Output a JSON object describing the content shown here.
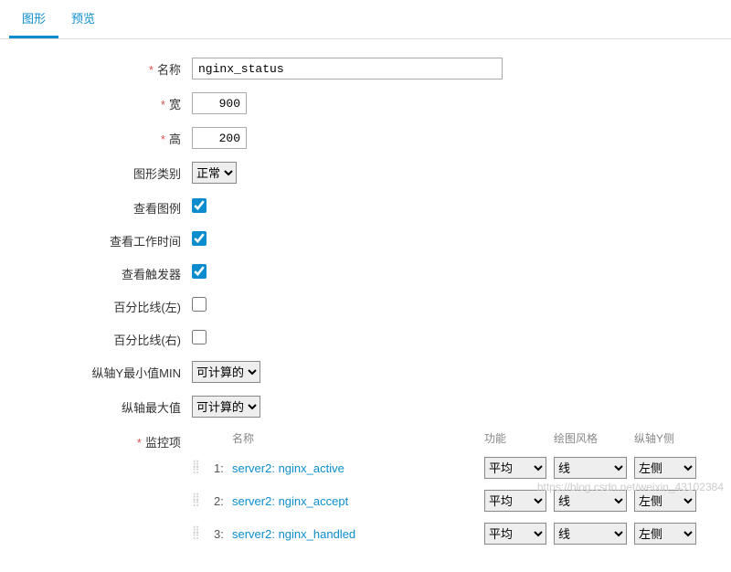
{
  "tabs": {
    "graph": "图形",
    "preview": "预览"
  },
  "labels": {
    "name": "名称",
    "width": "宽",
    "height": "高",
    "graphType": "图形类别",
    "showLegend": "查看图例",
    "showWorkTime": "查看工作时间",
    "showTriggers": "查看触发器",
    "percentLeft": "百分比线(左)",
    "percentRight": "百分比线(右)",
    "yAxisMin": "纵轴Y最小值MIN",
    "yAxisMax": "纵轴最大值",
    "monitorItems": "监控项"
  },
  "values": {
    "name": "nginx_status",
    "width": "900",
    "height": "200",
    "graphType": "正常",
    "showLegend": true,
    "showWorkTime": true,
    "showTriggers": true,
    "percentLeft": false,
    "percentRight": false,
    "yAxisMin": "可计算的",
    "yAxisMax": "可计算的"
  },
  "monitor": {
    "headers": {
      "name": "名称",
      "func": "功能",
      "style": "绘图风格",
      "side": "纵轴Y侧"
    },
    "funcOption": "平均",
    "styleOption": "线",
    "sideOption": "左侧",
    "items": [
      {
        "idx": "1:",
        "name": "server2: nginx_active"
      },
      {
        "idx": "2:",
        "name": "server2: nginx_accept"
      },
      {
        "idx": "3:",
        "name": "server2: nginx_handled"
      }
    ]
  },
  "watermark": "https://blog.csdn.net/weixin_43102384"
}
